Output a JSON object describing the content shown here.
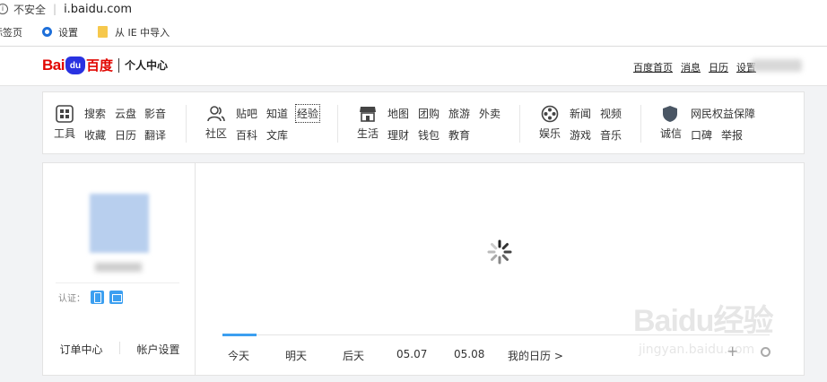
{
  "browser": {
    "insecure_label": "不安全",
    "url": "i.baidu.com",
    "bookmarks": {
      "newtab": "标签页",
      "settings": "设置",
      "import_ie": "从 IE 中导入"
    }
  },
  "header": {
    "logo_bai": "Bai",
    "logo_du": "du",
    "logo_cn": "百度",
    "page_title": "个人中心",
    "links": {
      "home": "百度首页",
      "messages": "消息",
      "calendar": "日历",
      "settings": "设置"
    }
  },
  "services": {
    "tools": {
      "label": "工具",
      "row1": [
        "搜索",
        "云盘",
        "影音"
      ],
      "row2": [
        "收藏",
        "日历",
        "翻译"
      ]
    },
    "community": {
      "label": "社区",
      "row1": [
        "贴吧",
        "知道",
        "经验"
      ],
      "row2": [
        "百科",
        "文库"
      ]
    },
    "life": {
      "label": "生活",
      "row1": [
        "地图",
        "团购",
        "旅游",
        "外卖"
      ],
      "row2": [
        "理财",
        "钱包",
        "教育"
      ]
    },
    "entertainment": {
      "label": "娱乐",
      "row1": [
        "新闻",
        "视频"
      ],
      "row2": [
        "游戏",
        "音乐"
      ]
    },
    "integrity": {
      "label": "诚信",
      "row1": [
        "网民权益保障"
      ],
      "row2": [
        "口碑",
        "举报"
      ]
    }
  },
  "profile": {
    "auth_label": "认证：",
    "order_center": "订单中心",
    "account_settings": "帐户设置"
  },
  "calendar": {
    "tabs": [
      "今天",
      "明天",
      "后天",
      "05.07",
      "05.08",
      "我的日历 >"
    ],
    "active_tab": "今天",
    "add_symbol": "+"
  },
  "watermark": {
    "title": "Baidu经验",
    "subtitle": "jingyan.baidu.com"
  },
  "colors": {
    "accent": "#3c9ff0",
    "brand_red": "#e10601",
    "brand_blue": "#2932e1"
  }
}
